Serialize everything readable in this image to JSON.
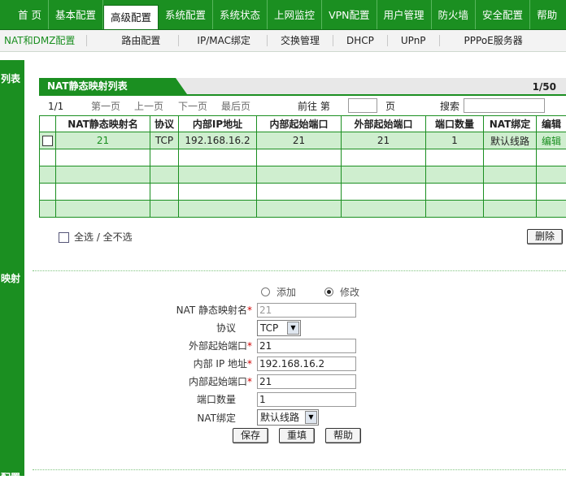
{
  "top_nav": [
    "首 页",
    "基本配置",
    "高级配置",
    "系统配置",
    "系统状态",
    "上网监控",
    "VPN配置",
    "用户管理",
    "防火墙",
    "安全配置",
    "帮助"
  ],
  "sub_nav": [
    "NAT和DMZ配置",
    "路由配置",
    "IP/MAC绑定",
    "交换管理",
    "DHCP",
    "UPnP",
    "PPPoE服务器"
  ],
  "left_labels": [
    "列表",
    "映射",
    "配置"
  ],
  "list": {
    "title": "NAT静态映射列表",
    "page_indicator": "1/50",
    "pager": {
      "current": "1/1",
      "first": "第一页",
      "prev": "上一页",
      "next": "下一页",
      "last": "最后页",
      "goto_label": "前往 第",
      "page_unit": "页",
      "search_label": "搜索",
      "goto_value": "",
      "search_value": ""
    },
    "columns": [
      "NAT静态映射名",
      "协议",
      "内部IP地址",
      "内部起始端口",
      "外部起始端口",
      "端口数量",
      "NAT绑定",
      "编辑"
    ],
    "rows": [
      {
        "name": "21",
        "protocol": "TCP",
        "internal_ip": "192.168.16.2",
        "internal_port": "21",
        "external_port": "21",
        "count": "1",
        "binding": "默认线路",
        "edit": "编辑"
      }
    ],
    "select_all": "全选 / 全不选",
    "delete": "删除"
  },
  "form": {
    "mode_add": "添加",
    "mode_edit": "修改",
    "mode_selected": "edit",
    "name_label": "NAT 静态映射名",
    "name_value": "21",
    "protocol_label": "协议",
    "protocol_value": "TCP",
    "ext_port_label": "外部起始端口",
    "ext_port_value": "21",
    "int_ip_label": "内部 IP 地址",
    "int_ip_value": "192.168.16.2",
    "int_port_label": "内部起始端口",
    "int_port_value": "21",
    "count_label": "端口数量",
    "count_value": "1",
    "binding_label": "NAT绑定",
    "binding_value": "默认线路",
    "required_mark": "*",
    "save": "保存",
    "reset": "重填",
    "help": "帮助"
  },
  "colors": {
    "brand_green": "#1b8f21",
    "row_green": "#cfeecf",
    "required_red": "#d00000"
  }
}
